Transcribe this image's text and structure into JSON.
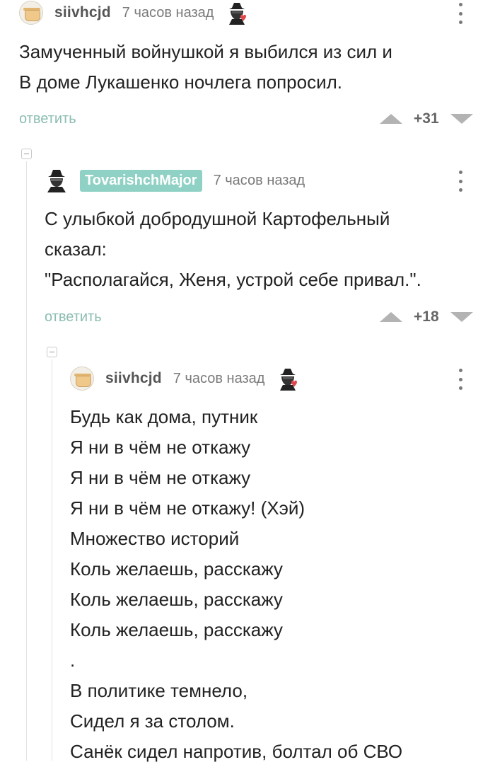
{
  "comments": [
    {
      "username": "siivhcjd",
      "time": "7 часов назад",
      "lines": [
        "Замученный войнушкой я выбился из сил и",
        "В доме Лукашенко ночлега попросил."
      ],
      "reply_label": "ответить",
      "score": "+31"
    },
    {
      "username": "TovarishchMajor",
      "time": "7 часов назад",
      "lines": [
        "С улыбкой добродушной Картофельный",
        "сказал:",
        "\"Располагайся, Женя, устрой себе привал.\"."
      ],
      "reply_label": "ответить",
      "score": "+18"
    },
    {
      "username": "siivhcjd",
      "time": "7 часов назад",
      "lines": [
        "Будь как дома, путник",
        "Я ни в чём не откажу",
        "Я ни в чём не откажу",
        "Я ни в чём не откажу! (Хэй)",
        "Множество историй",
        "Коль желаешь, расскажу",
        "Коль желаешь, расскажу",
        "Коль желаешь, расскажу",
        ".",
        "В политике темнело,",
        "Сидел я за столом.",
        "Санёк сидел напротив, болтал об СВО"
      ]
    }
  ],
  "icons": {
    "avatar_1": "pot-avatar-icon",
    "avatar_2": "spy-avatar-icon",
    "badge": "spy-heart-icon",
    "menu": "kebab-menu-icon",
    "upvote": "upvote-icon",
    "downvote": "downvote-icon",
    "collapse": "collapse-icon"
  },
  "colors": {
    "badge_bg": "#8fd1c4",
    "link": "#8bbdb2",
    "vote": "#b3b3b3"
  }
}
